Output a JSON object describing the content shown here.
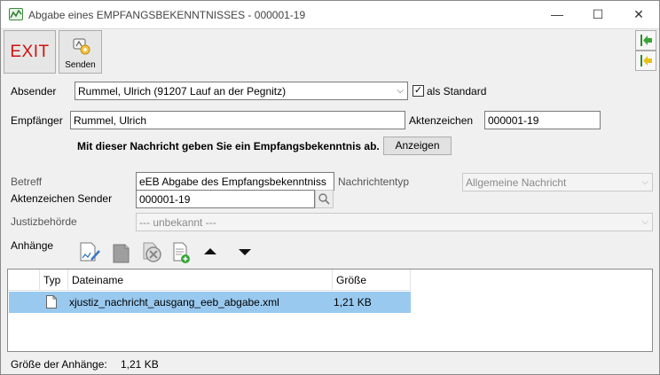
{
  "window": {
    "title": "Abgabe eines EMPFANGSBEKENNTNISSES - 000001-19",
    "minimize_glyph": "—",
    "maximize_glyph": "☐",
    "close_glyph": "✕"
  },
  "toolbar": {
    "exit_label": "EXIT",
    "send_label": "Senden",
    "send_icon": "send-message-icon",
    "nav_first_icon": "arrow-left-first-icon",
    "nav_prev_icon": "arrow-left-prev-icon"
  },
  "form": {
    "absender_label": "Absender",
    "absender_value": "Rummel, Ulrich (91207 Lauf an der Pegnitz)",
    "als_standard_label": "als Standard",
    "als_standard_checked": true,
    "empfaenger_label": "Empfänger",
    "empfaenger_value": "Rummel, Ulrich",
    "aktenzeichen_label": "Aktenzeichen",
    "aktenzeichen_value": "000001-19",
    "notice": "Mit dieser Nachricht geben Sie ein Empfangsbekenntnis ab.",
    "anzeigen_label": "Anzeigen",
    "betreff_label": "Betreff",
    "betreff_value": "eEB Abgabe des Empfangsbekenntniss",
    "nachrichtentyp_label": "Nachrichtentyp",
    "nachrichtentyp_value": "Allgemeine Nachricht",
    "az_sender_label": "Aktenzeichen Sender",
    "az_sender_value": "000001-19",
    "justiz_label": "Justizbehörde",
    "justiz_value": "--- unbekannt ---"
  },
  "attachments": {
    "label": "Anhänge",
    "tools": [
      "edit-attachment-icon",
      "open-attachment-icon",
      "remove-attachment-icon",
      "add-attachment-icon",
      "move-up-icon",
      "move-down-icon"
    ],
    "columns": [
      "Typ",
      "Dateiname",
      "Größe"
    ],
    "rows": [
      {
        "type_icon": "file-icon",
        "name": "xjustiz_nachricht_ausgang_eeb_abgabe.xml",
        "size": "1,21 KB"
      }
    ],
    "size_label": "Größe der Anhänge:",
    "size_value": "1,21 KB"
  }
}
